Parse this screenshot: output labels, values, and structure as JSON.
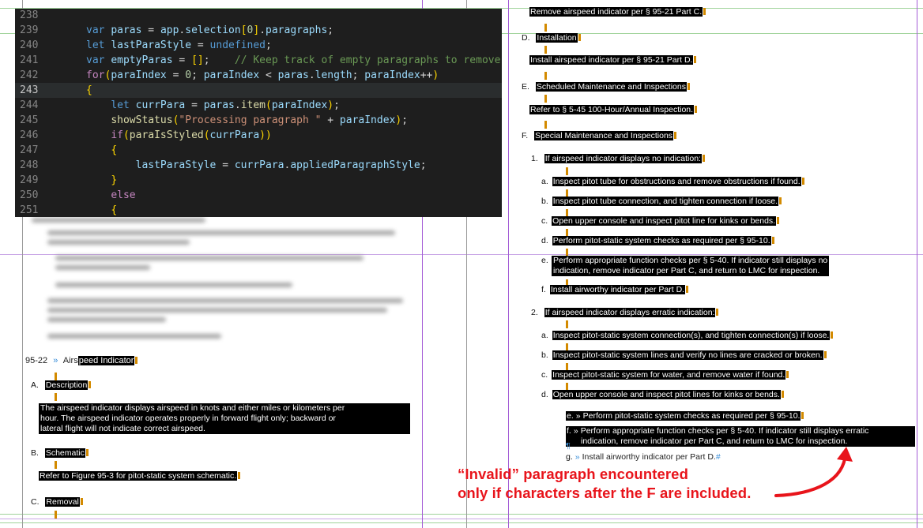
{
  "editor": {
    "lines": [
      {
        "n": "238",
        "code": ""
      },
      {
        "n": "239",
        "code": "var paras = app.selection[0].paragraphs;"
      },
      {
        "n": "240",
        "code": "let lastParaStyle = undefined;"
      },
      {
        "n": "241",
        "code": "var emptyParas = [];    // Keep track of empty paragraphs to remove."
      },
      {
        "n": "242",
        "code": "for(paraIndex = 0; paraIndex < paras.length; paraIndex++)"
      },
      {
        "n": "243",
        "code": "{"
      },
      {
        "n": "244",
        "code": "    let currPara = paras.item(paraIndex);"
      },
      {
        "n": "245",
        "code": "    showStatus(\"Processing paragraph \" + paraIndex);"
      },
      {
        "n": "246",
        "code": "    if(paraIsStyled(currPara))"
      },
      {
        "n": "247",
        "code": "    {"
      },
      {
        "n": "248",
        "code": "        lastParaStyle = currPara.appliedParagraphStyle;"
      },
      {
        "n": "249",
        "code": "    }"
      },
      {
        "n": "250",
        "code": "    else"
      },
      {
        "n": "251",
        "code": "    {"
      }
    ]
  },
  "left": {
    "heading_num": "95-22",
    "heading_sep": "»",
    "heading_pre": "Airs",
    "heading_hl": "peed Indicator",
    "a_label": "A.",
    "a_title": "Description",
    "a_body": [
      "The airspeed indicator displays airspeed in knots and either miles or kilometers per",
      "hour.  The airspeed indicator operates properly in forward flight only; backward or",
      "lateral flight will not indicate correct airspeed."
    ],
    "b_label": "B.",
    "b_title": "Schematic",
    "b_body": "Refer to Figure 95-3 for pitot-static system schematic.",
    "c_label": "C.",
    "c_title": "Removal"
  },
  "right": {
    "top_line": "Remove airspeed indicator per § 95-21 Part C.",
    "d_label": "D.",
    "d_title": "Installation",
    "d_body": "Install airspeed indicator per § 95-21 Part D.",
    "e_label": "E.",
    "e_title": "Scheduled Maintenance and Inspections",
    "e_body": "Refer to § 5-45 100-Hour/Annual Inspection.",
    "f_label": "F.",
    "f_title": "Special Maintenance and Inspections",
    "f1_label": "1.",
    "f1_text": "If airspeed indicator displays no indication:",
    "f1_items": [
      {
        "l": "a.",
        "t": "Inspect pitot tube for obstructions and remove obstructions if found."
      },
      {
        "l": "b.",
        "t": "Inspect pitot tube connection, and tighten connection if loose."
      },
      {
        "l": "c.",
        "t": "Open upper console and inspect pitot line for kinks or bends."
      },
      {
        "l": "d.",
        "t": "Perform pitot-static system checks as required per § 95-10."
      },
      {
        "l": "e.",
        "t": "Perform appropriate function checks per § 5-40.  If indicator still displays no",
        "t2": "indication, remove indicator per Part C, and return to LMC for inspection."
      },
      {
        "l": "f.",
        "t": "Install airworthy indicator per Part D."
      }
    ],
    "f2_label": "2.",
    "f2_text": "If airspeed indicator displays erratic indication:",
    "f2_items": [
      {
        "l": "a.",
        "t": "Inspect pitot-static system connection(s), and tighten connection(s) if loose."
      },
      {
        "l": "b.",
        "t": "Inspect pitot-static system lines and verify no lines are cracked or broken."
      },
      {
        "l": "c.",
        "t": "Inspect pitot-static system for water, and remove water if found."
      },
      {
        "l": "d.",
        "t": "Open upper console and inspect pitot lines for kinks or bends."
      }
    ],
    "e_bad_label": "e.",
    "e_bad_text": "Perform pitot-static system checks as required per § 95-10.",
    "f_bad_label": "f.",
    "f_bad_text": "Perform appropriate function checks per § 5-40.  If indicator still displays erratic",
    "f_bad_text2": "indication, remove indicator per Part C, and return to LMC for inspection.",
    "g_label": "g.",
    "g_text": "Install airworthy indicator per Part D."
  },
  "annotation": {
    "line1": "“Invalid” paragraph encountered",
    "line2": "only if characters after the F are included.",
    "color": "#e8141b"
  }
}
